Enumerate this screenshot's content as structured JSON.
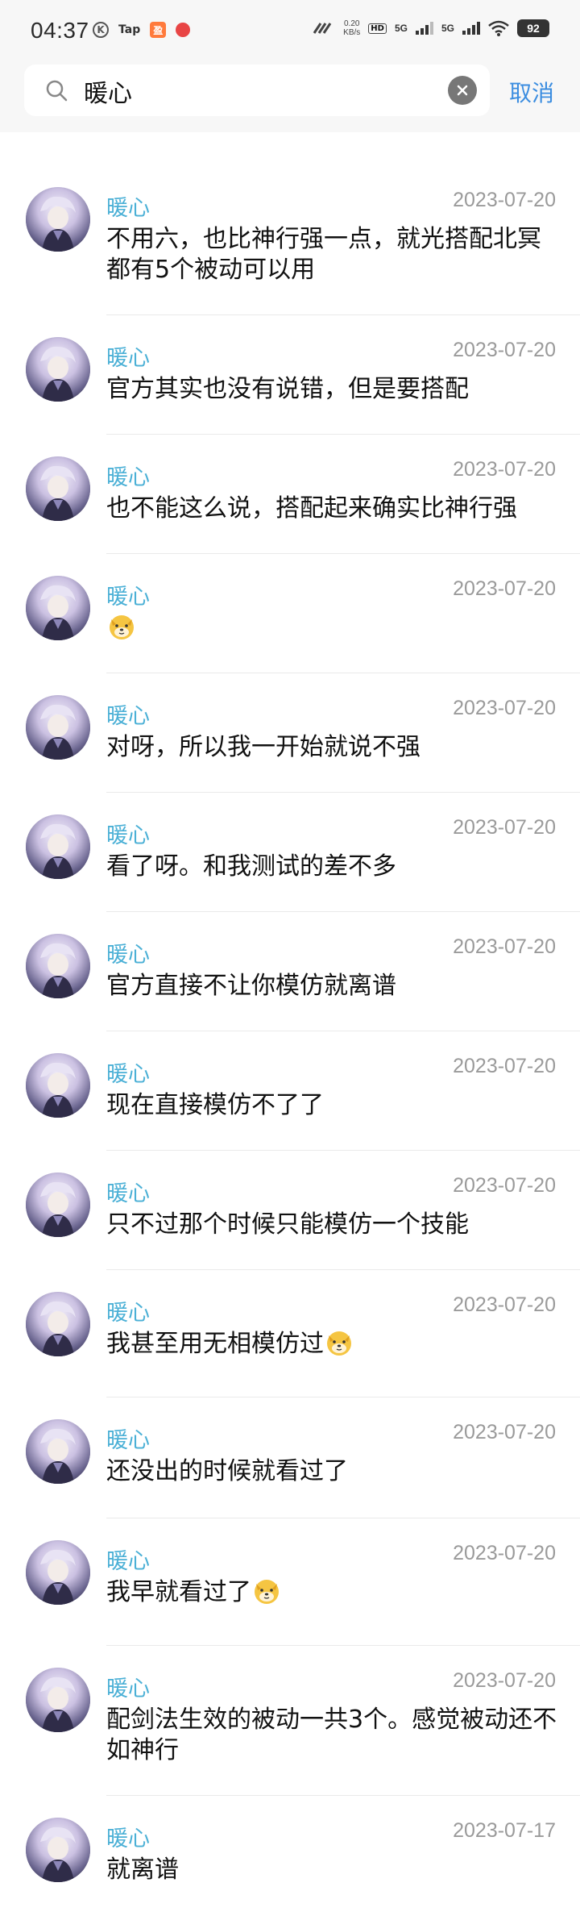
{
  "status_bar": {
    "time": "04:37",
    "left_icons": [
      "k-icon",
      "taptap-icon",
      "app-orange-icon",
      "app-red-icon"
    ],
    "network_speed_value": "0.20",
    "network_speed_unit": "KB/s",
    "hd_label": "HD",
    "net1": "5G",
    "net2": "5G",
    "battery": "92"
  },
  "search": {
    "query": "暖心",
    "cancel_label": "取消"
  },
  "messages": [
    {
      "sender": "暖心",
      "date": "2023-07-20",
      "text": "不用六，也比神行强一点，就光搭配北冥都有5个被动可以用"
    },
    {
      "sender": "暖心",
      "date": "2023-07-20",
      "text": "官方其实也没有说错，但是要搭配"
    },
    {
      "sender": "暖心",
      "date": "2023-07-20",
      "text": "也不能这么说，搭配起来确实比神行强"
    },
    {
      "sender": "暖心",
      "date": "2023-07-20",
      "text": "",
      "emoji": "doge-emoji"
    },
    {
      "sender": "暖心",
      "date": "2023-07-20",
      "text": "对呀，所以我一开始就说不强"
    },
    {
      "sender": "暖心",
      "date": "2023-07-20",
      "text": "看了呀。和我测试的差不多"
    },
    {
      "sender": "暖心",
      "date": "2023-07-20",
      "text": "官方直接不让你模仿就离谱"
    },
    {
      "sender": "暖心",
      "date": "2023-07-20",
      "text": "现在直接模仿不了了"
    },
    {
      "sender": "暖心",
      "date": "2023-07-20",
      "text": "只不过那个时候只能模仿一个技能"
    },
    {
      "sender": "暖心",
      "date": "2023-07-20",
      "text": "我甚至用无相模仿过",
      "emoji": "doge-emoji"
    },
    {
      "sender": "暖心",
      "date": "2023-07-20",
      "text": "还没出的时候就看过了"
    },
    {
      "sender": "暖心",
      "date": "2023-07-20",
      "text": "我早就看过了",
      "emoji": "doge-emoji"
    },
    {
      "sender": "暖心",
      "date": "2023-07-20",
      "text": "配剑法生效的被动一共3个。感觉被动还不如神行"
    },
    {
      "sender": "暖心",
      "date": "2023-07-17",
      "text": "就离谱"
    }
  ],
  "colors": {
    "accent": "#3b8de0",
    "sender": "#4bb0d6",
    "date": "#9a9a9a",
    "text": "#111111"
  }
}
